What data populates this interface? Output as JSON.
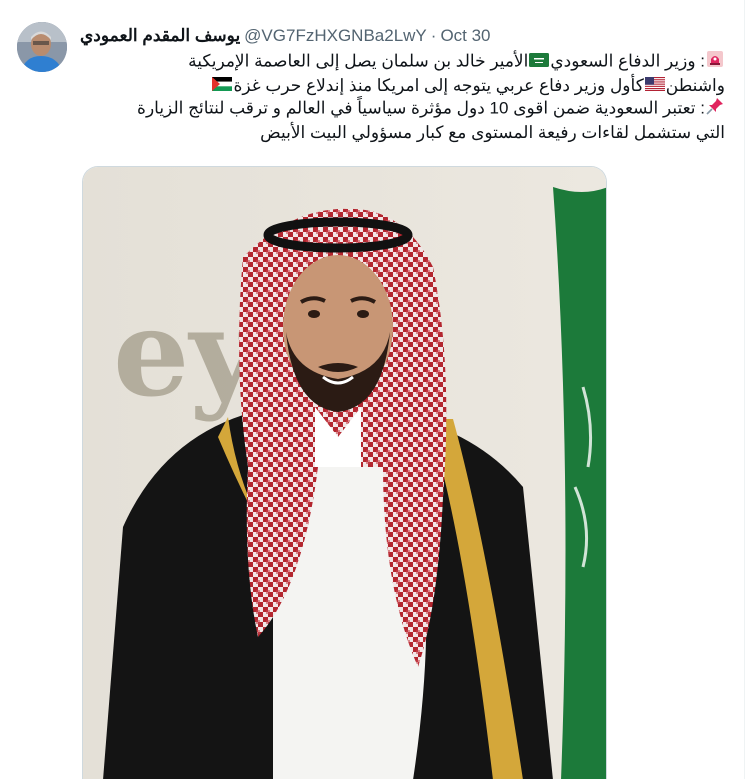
{
  "tweet": {
    "author_name": "يوسف المقدم العمودي",
    "handle": "@VG7FzHXGNBa2LwY",
    "separator": "·",
    "time": "Oct 30",
    "lines": [
      [
        "وزير الدفاع السعودي",
        "الأمير خالد بن سلمان يصل إلى العاصمة الإمريكية"
      ],
      [
        "واشنطن",
        "كأول وزير دفاع عربي يتوجه إلى امريكا منذ إندلاع حرب غزة"
      ],
      [
        "تعتبر السعودية ضمن اقوى 10 دول مؤثرة سياسياً في العالم و ترقب لنتائج الزيارة"
      ],
      [
        "التي ستشمل لقاءات رفيعة المستوى مع كبار مسؤولي البيت الأبيض"
      ]
    ],
    "line1_prefix": ": ",
    "line3_prefix": ": "
  },
  "photo": {
    "backdrop_text": "ey"
  },
  "icons": {
    "line1_lead": "rotating-light-icon",
    "line1_flag": "saudi-flag-icon",
    "line2_flag_us": "us-flag-icon",
    "line2_flag_ps": "palestine-flag-icon",
    "line3_lead": "pushpin-icon"
  },
  "colors": {
    "text": "#0f1419",
    "secondary": "#536471",
    "saudi_green": "#1c7a3a"
  }
}
